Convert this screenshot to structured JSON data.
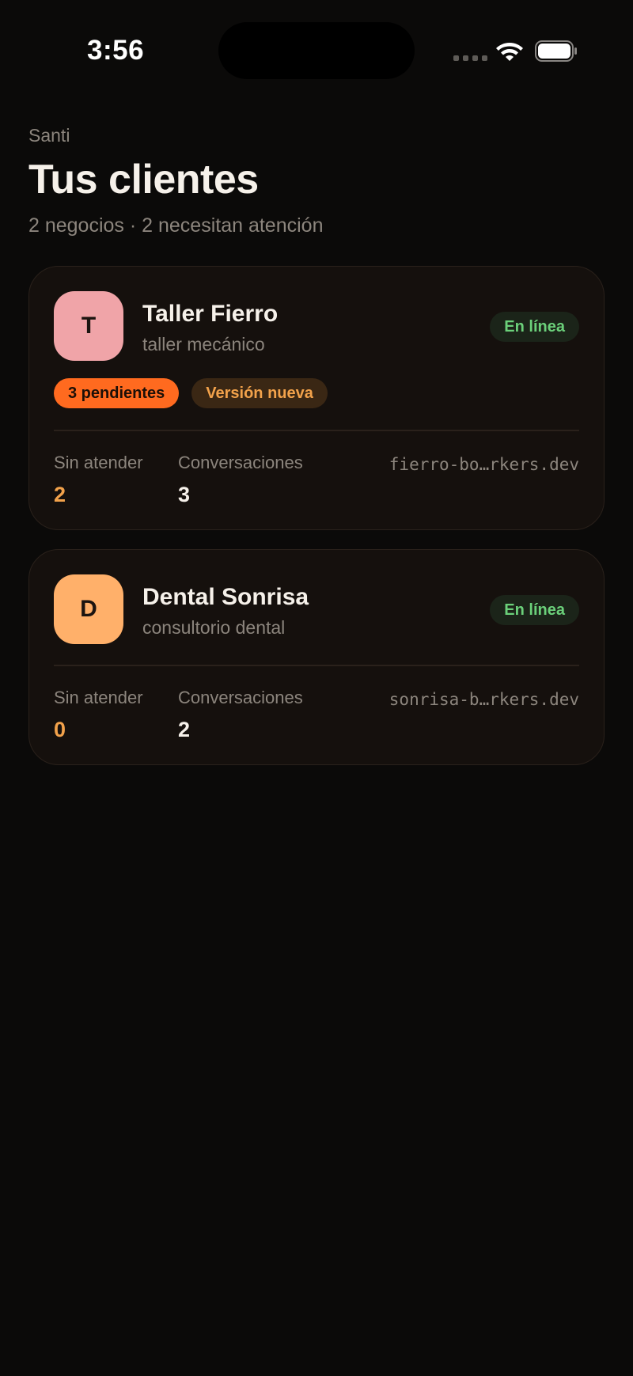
{
  "status_bar": {
    "time": "3:56"
  },
  "header": {
    "user": "Santi",
    "title": "Tus clientes",
    "subtitle": "2 negocios · 2 necesitan atención"
  },
  "clients": [
    {
      "initial": "T",
      "avatar_color": "#f0a4a8",
      "name": "Taller Fierro",
      "type": "taller mecánico",
      "status": "En línea",
      "tags": [
        "3 pendientes",
        "Versión nueva"
      ],
      "unattended_label": "Sin atender",
      "unattended": "2",
      "conversations_label": "Conversaciones",
      "conversations": "3",
      "url": "fierro-bo…rkers.dev"
    },
    {
      "initial": "D",
      "avatar_color": "#ffb06a",
      "name": "Dental Sonrisa",
      "type": "consultorio dental",
      "status": "En línea",
      "tags": [],
      "unattended_label": "Sin atender",
      "unattended": "0",
      "conversations_label": "Conversaciones",
      "conversations": "2",
      "url": "sonrisa-b…rkers.dev"
    }
  ],
  "colors": {
    "background": "#0b0a09",
    "card": "#15100d",
    "online": "#6bd07a",
    "accent": "#f2a24b",
    "pending": "#ff6a1f"
  },
  "icons": {
    "signal": "cellular-signal-icon",
    "wifi": "wifi-icon",
    "battery": "battery-icon"
  }
}
